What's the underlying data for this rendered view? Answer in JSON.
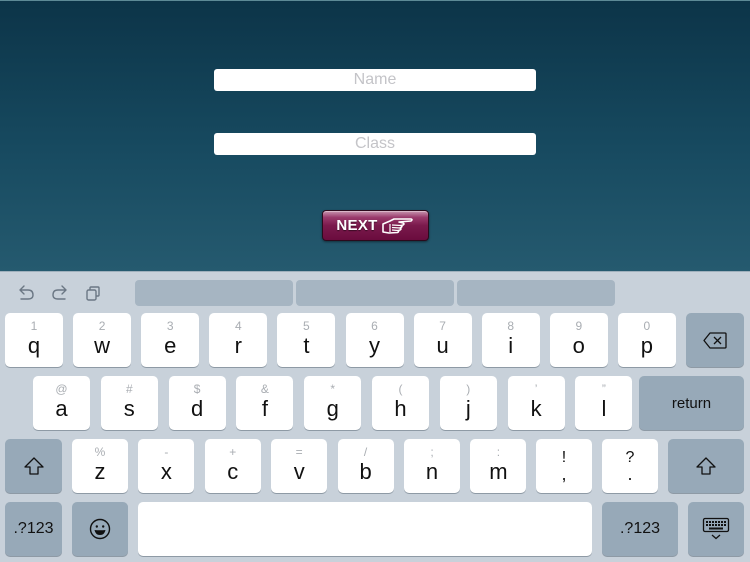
{
  "form": {
    "name_placeholder": "Name",
    "name_value": "",
    "class_placeholder": "Class",
    "class_value": "",
    "next_label": "NEXT",
    "next_icon": "pointing-hand-icon",
    "next_color": "#7a1a4c"
  },
  "keyboard": {
    "toolbar": {
      "icons": [
        "undo-icon",
        "redo-icon",
        "paste-icon"
      ],
      "predictions": [
        "",
        "",
        ""
      ]
    },
    "row1": [
      {
        "ch": "q",
        "sym": "1"
      },
      {
        "ch": "w",
        "sym": "2"
      },
      {
        "ch": "e",
        "sym": "3"
      },
      {
        "ch": "r",
        "sym": "4"
      },
      {
        "ch": "t",
        "sym": "5"
      },
      {
        "ch": "y",
        "sym": "6"
      },
      {
        "ch": "u",
        "sym": "7"
      },
      {
        "ch": "i",
        "sym": "8"
      },
      {
        "ch": "o",
        "sym": "9"
      },
      {
        "ch": "p",
        "sym": "0"
      }
    ],
    "row2": [
      {
        "ch": "a",
        "sym": "@"
      },
      {
        "ch": "s",
        "sym": "#"
      },
      {
        "ch": "d",
        "sym": "$"
      },
      {
        "ch": "f",
        "sym": "&"
      },
      {
        "ch": "g",
        "sym": "*"
      },
      {
        "ch": "h",
        "sym": "("
      },
      {
        "ch": "j",
        "sym": ")"
      },
      {
        "ch": "k",
        "sym": "’"
      },
      {
        "ch": "l",
        "sym": "”"
      }
    ],
    "row3": [
      {
        "ch": "z",
        "sym": "%"
      },
      {
        "ch": "x",
        "sym": "-"
      },
      {
        "ch": "c",
        "sym": "+"
      },
      {
        "ch": "v",
        "sym": "="
      },
      {
        "ch": "b",
        "sym": "/"
      },
      {
        "ch": "n",
        "sym": ";"
      },
      {
        "ch": "m",
        "sym": ":"
      }
    ],
    "punct": [
      {
        "top": "!",
        "bottom": ","
      },
      {
        "top": "?",
        "bottom": "."
      }
    ],
    "return_label": "return",
    "numbers_label": ".?123",
    "space_label": "",
    "colors": {
      "background": "#c8d1da",
      "key": "#ffffff",
      "special_key": "#97a9b8",
      "prediction_slot": "#a6b5c2"
    }
  }
}
